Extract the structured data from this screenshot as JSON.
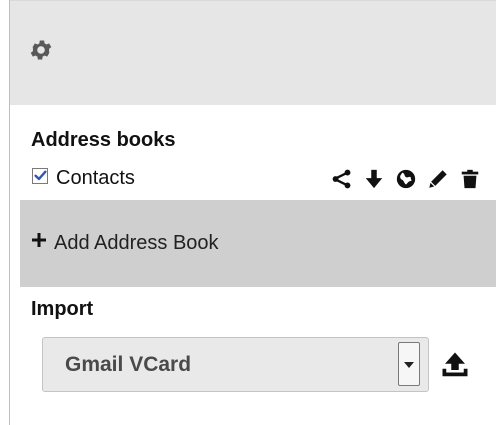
{
  "colors": {
    "header_bg": "#e6e6e6",
    "highlight_row_bg": "#cfcfcf",
    "select_bg": "#e9e9e9",
    "checkbox_check": "#2f56b8",
    "icon": "#111111"
  },
  "header": {
    "settings_icon": "gear-icon"
  },
  "address_books": {
    "title": "Address books",
    "items": [
      {
        "label": "Contacts",
        "checked": true,
        "actions": [
          "share-icon",
          "download-icon",
          "globe-icon",
          "pencil-icon",
          "trash-icon"
        ]
      }
    ],
    "add_label": "Add Address Book"
  },
  "import": {
    "title": "Import",
    "selected": "Gmail VCard",
    "upload_icon": "upload-icon"
  }
}
